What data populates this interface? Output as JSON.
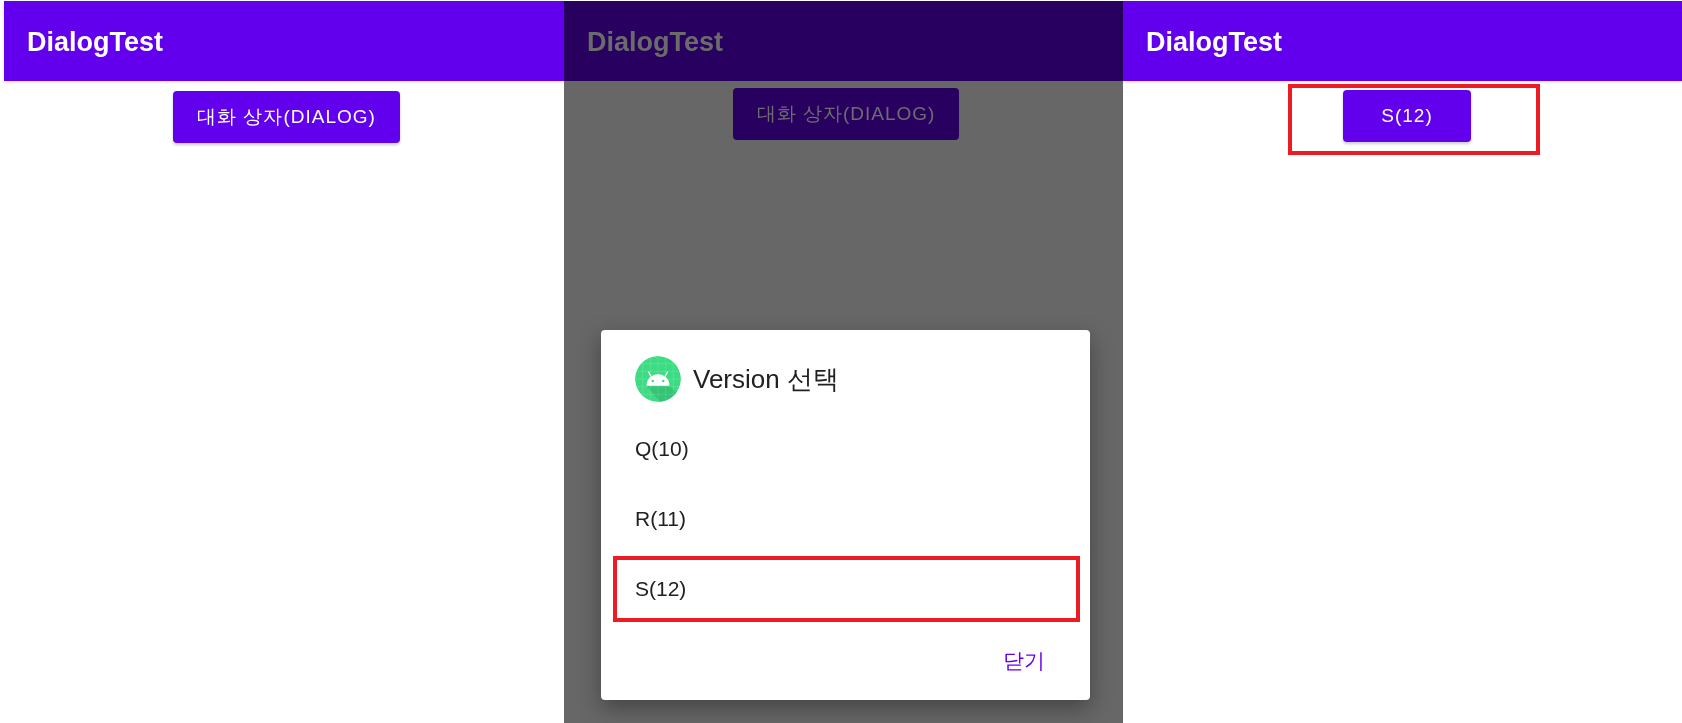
{
  "screens": [
    {
      "dimmed": false,
      "app_bar": {
        "title": "DialogTest"
      },
      "button": {
        "label": "대화 상자(DIALOG)",
        "highlighted": false
      }
    },
    {
      "dimmed": true,
      "app_bar": {
        "title": "DialogTest"
      },
      "button": {
        "label": "대화 상자(DIALOG)",
        "highlighted": false
      },
      "dialog": {
        "title": "Version 선택",
        "items": [
          {
            "label": "Q(10)",
            "highlighted": false
          },
          {
            "label": "R(11)",
            "highlighted": false
          },
          {
            "label": "S(12)",
            "highlighted": true
          }
        ],
        "close_button": "닫기"
      }
    },
    {
      "dimmed": false,
      "app_bar": {
        "title": "DialogTest"
      },
      "button": {
        "label": "S(12)",
        "highlighted": true
      }
    }
  ]
}
